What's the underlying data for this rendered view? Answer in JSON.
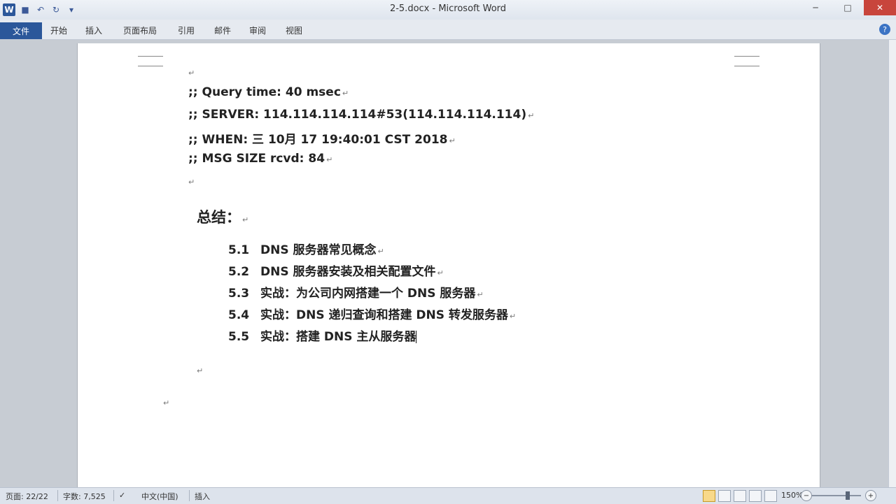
{
  "window": {
    "title": "2-5.docx - Microsoft Word",
    "minimize": "─",
    "maximize": "□",
    "close": "✕"
  },
  "ribbon": {
    "file_tab": "文件",
    "tabs": [
      "开始",
      "插入",
      "页面布局",
      "引用",
      "邮件",
      "审阅",
      "视图"
    ]
  },
  "document": {
    "lines": [
      ";; Query time: 40 msec",
      ";; SERVER: 114.114.114.114#53(114.114.114.114)",
      ";; WHEN: 三 10月 17 19:40:01 CST 2018",
      ";; MSG SIZE  rcvd: 84"
    ],
    "summary_title": "总结：",
    "summary_items": [
      {
        "num": "5.1",
        "text": "DNS 服务器常见概念"
      },
      {
        "num": "5.2",
        "text": "DNS 服务器安装及相关配置文件"
      },
      {
        "num": "5.3",
        "text": "实战：为公司内网搭建一个 DNS 服务器"
      },
      {
        "num": "5.4",
        "text": "实战：DNS 递归查询和搭建 DNS 转发服务器"
      },
      {
        "num": "5.5",
        "text": "实战：搭建 DNS 主从服务器"
      }
    ],
    "paragraph_mark": "↵"
  },
  "statusbar": {
    "page": "页面: 22/22",
    "words": "字数: 7,525",
    "language": "中文(中国)",
    "mode": "插入",
    "zoom": "150%"
  }
}
